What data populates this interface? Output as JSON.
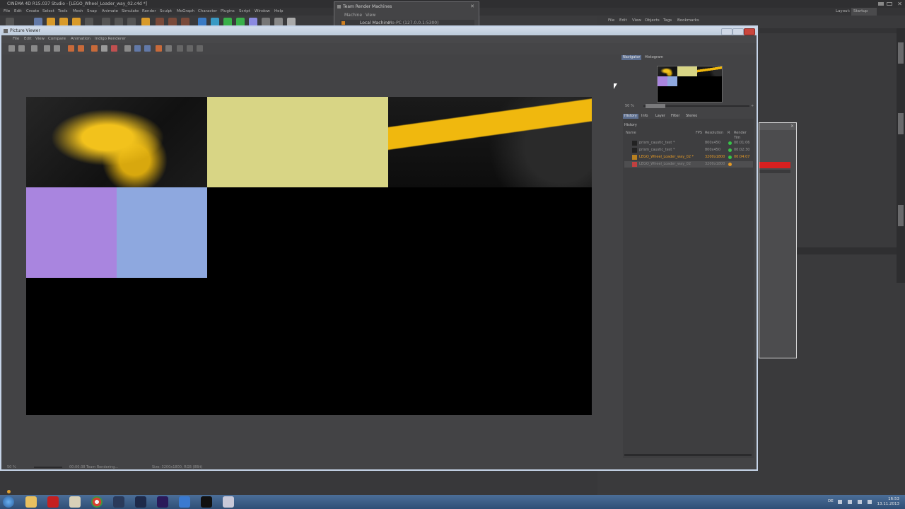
{
  "c4d": {
    "title": "CINEMA 4D R15.037 Studio - [LEGO_Wheel_Loader_way_02.c4d *]",
    "menu": [
      "File",
      "Edit",
      "Create",
      "Select",
      "Tools",
      "Mesh",
      "Snap",
      "Animate",
      "Simulate",
      "Render",
      "Sculpt",
      "MoGraph",
      "Character",
      "Plugins",
      "Script",
      "Window",
      "Help"
    ],
    "layout_label": "Layout:",
    "layout_value": "Startup",
    "object_menu": [
      "File",
      "Edit",
      "View",
      "Objects",
      "Tags",
      "Bookmarks"
    ]
  },
  "team_render": {
    "title": "Team Render Machines",
    "menu": [
      "Machine",
      "View"
    ],
    "row_name": "Local Machine",
    "row_detail": "Mo-PC (127.0.0.1:5300)"
  },
  "picture_viewer": {
    "title": "Picture Viewer",
    "menu": [
      "File",
      "Edit",
      "View",
      "Compare",
      "Animation",
      "Indigo Renderer"
    ],
    "tabs_top": [
      "Navigator",
      "Histogram"
    ],
    "zoom": "50 %",
    "tabs_bottom": [
      "History",
      "Info",
      "Layer",
      "Filter",
      "Stereo"
    ],
    "history_label": "History",
    "columns": [
      "Name",
      "FPS",
      "Resolution",
      "R",
      "Render Tim"
    ],
    "history": [
      {
        "name": "prism_caustic_test *",
        "resolution": "800x450",
        "time": "00:01:06",
        "dot": "#38c449",
        "color": "#9a9a9a"
      },
      {
        "name": "prism_caustic_test *",
        "resolution": "800x450",
        "time": "00:02:30",
        "dot": "#38c449",
        "color": "#9a9a9a"
      },
      {
        "name": "LEGO_Wheel_Loader_way_02 *",
        "resolution": "3200x1800",
        "time": "00:04:07",
        "dot": "#38c449",
        "color": "#e59a25"
      },
      {
        "name": "LEGO_Wheel_Loader_way_02",
        "resolution": "3200x1800",
        "time": "",
        "dot": "#e59a25",
        "color": "#8a8a8a"
      }
    ],
    "status_zoom": "50 %",
    "status_render": "00:00:38 Team Rendering...",
    "status_size": "Size: 3200x1800, RGB (8Bit)"
  },
  "render_tiles": {
    "tan": "#d8d585",
    "purple": "#a985df",
    "blue": "#8ea8df"
  },
  "taskbar": {
    "lang": "DE",
    "time": "16:53",
    "date": "13.11.2013"
  }
}
